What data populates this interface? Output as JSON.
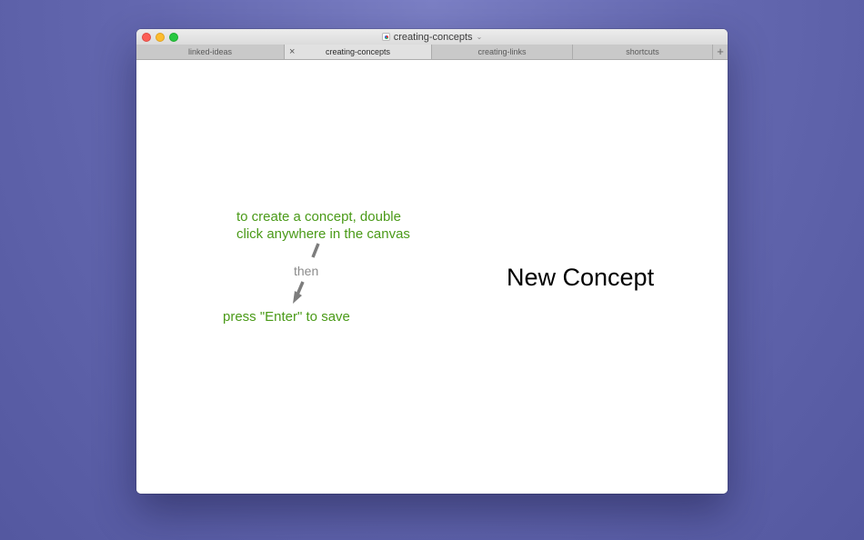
{
  "window": {
    "title": "creating-concepts",
    "title_chevron": "⌄"
  },
  "tabs": [
    {
      "label": "linked-ideas",
      "active": false
    },
    {
      "label": "creating-concepts",
      "active": true
    },
    {
      "label": "creating-links",
      "active": false
    },
    {
      "label": "shortcuts",
      "active": false
    }
  ],
  "tab_controls": {
    "close_glyph": "×",
    "add_glyph": "+"
  },
  "canvas": {
    "hint_line1": "to create a concept, double",
    "hint_line2": "click anywhere in the canvas",
    "then_label": "then",
    "save_hint": "press \"Enter\" to save",
    "concept_text": "New Concept"
  },
  "colors": {
    "hint_green": "#4a9a18",
    "arrow_gray": "#7d7d7d",
    "desktop": "#6468b0"
  }
}
